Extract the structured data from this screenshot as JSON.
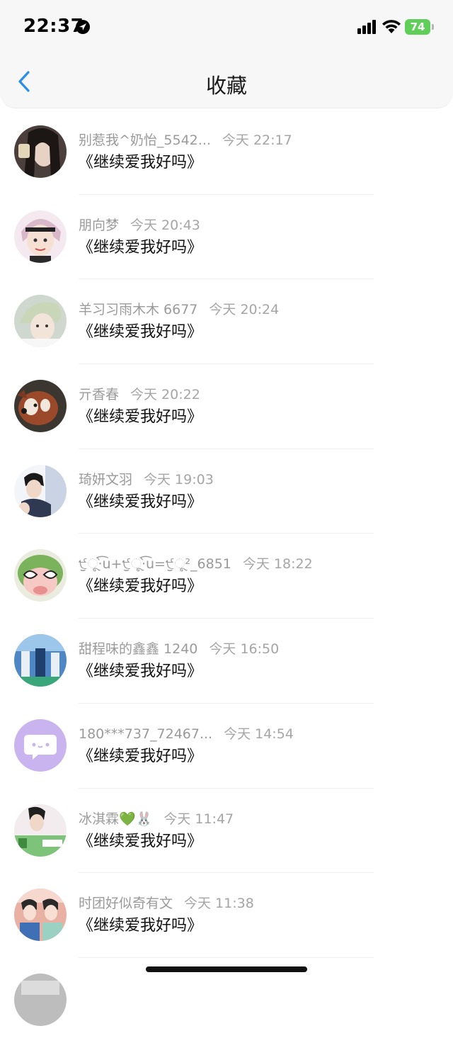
{
  "status_bar": {
    "time": "22:37",
    "battery": "74"
  },
  "header": {
    "title": "收藏",
    "back_icon": "chevron-left-icon"
  },
  "items": [
    {
      "name": "别惹我^奶怡_5542...",
      "time": "今天 22:17",
      "content": "《继续爱我好吗》",
      "avatar_color": "#4a3f3a"
    },
    {
      "name": "朋向梦",
      "time": "今天 20:43",
      "content": "《继续爱我好吗》",
      "avatar_color": "#d9b8c9"
    },
    {
      "name": "羊习习雨木木 6677",
      "time": "今天 20:24",
      "content": "《继续爱我好吗》",
      "avatar_color": "#cfd8cf"
    },
    {
      "name": "亓香春",
      "time": "今天 20:22",
      "content": "《继续爱我好吗》",
      "avatar_color": "#9a4a2a"
    },
    {
      "name": "琦妍文羽",
      "time": "今天 19:03",
      "content": "《继续爱我好吗》",
      "avatar_color": "#c9d3e3"
    },
    {
      "name": "੯ੁૂ‧̀͡u+੯ੁૂ‧̀͡u=੯ੁૂ²_6851",
      "time": "今天 18:22",
      "content": "《继续爱我好吗》",
      "avatar_color": "#7bb35c"
    },
    {
      "name": "甜程味的鑫鑫 1240",
      "time": "今天 16:50",
      "content": "《继续爱我好吗》",
      "avatar_color": "#4f86c4"
    },
    {
      "name": "180***737_72467...",
      "time": "今天 14:54",
      "content": "《继续爱我好吗》",
      "avatar_color": "#c9b4ef"
    },
    {
      "name": "冰淇霖💚🐰",
      "time": "今天 11:47",
      "content": "《继续爱我好吗》",
      "avatar_color": "#7dc37a"
    },
    {
      "name": "时团好似奇有文",
      "time": "今天 11:38",
      "content": "《继续爱我好吗》",
      "avatar_color": "#e9b0a4"
    },
    {
      "name": "",
      "time": "",
      "content": "",
      "avatar_color": "#bdbdbd"
    }
  ]
}
